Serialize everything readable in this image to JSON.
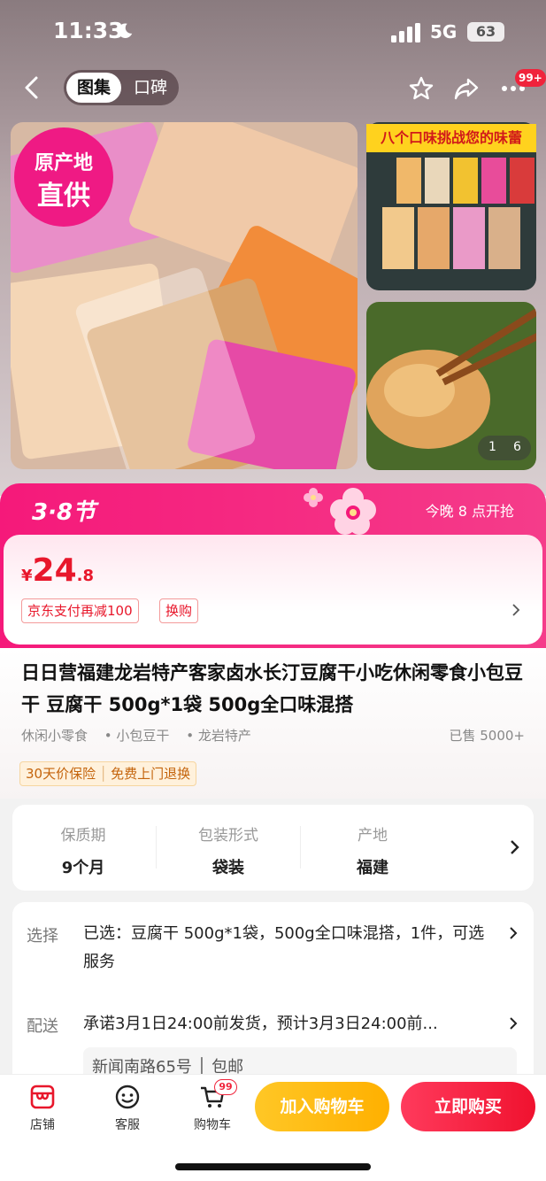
{
  "status_bar": {
    "time": "11:33",
    "network": "5G",
    "battery": "63"
  },
  "nav": {
    "tab_gallery": "图集",
    "tab_reviews": "口碑",
    "more_badge": "99+"
  },
  "gallery": {
    "origin_line1": "原产地",
    "origin_line2": "直供",
    "side_banner": "八个口味挑战您的味蕾",
    "pager_current": "1",
    "pager_total": "6"
  },
  "promo": {
    "title": "3·8节",
    "start_text": "今晚 8 点开抢",
    "currency": "¥",
    "price_int": "24",
    "price_dec": ".8",
    "tag_payment": "京东支付再减100",
    "tag_exchange": "换购"
  },
  "product": {
    "title": "日日营福建龙岩特产客家卤水长汀豆腐干小吃休闲零食小包豆干 豆腐干 500g*1袋 500g全口味混搭",
    "categories": [
      "休闲小零食",
      "• 小包豆干",
      "• 龙岩特产"
    ],
    "sold": "已售 5000+",
    "service_1": "30天价保险",
    "service_2": "免费上门退换"
  },
  "attributes": [
    {
      "key": "保质期",
      "value": "9个月"
    },
    {
      "key": "包装形式",
      "value": "袋装"
    },
    {
      "key": "产地",
      "value": "福建"
    }
  ],
  "selection": {
    "select_label": "选择",
    "select_text": "已选：豆腐干 500g*1袋，500g全口味混搭，1件，可选服务",
    "deliver_label": "配送",
    "deliver_text": "承诺3月1日24:00前发货，预计3月3日24:00前...",
    "address": "新闻南路65号 │ 包邮"
  },
  "bottom_bar": {
    "store": "店铺",
    "service": "客服",
    "cart": "购物车",
    "cart_badge": "99",
    "add_to_cart": "加入购物车",
    "buy_now": "立即购买"
  },
  "colors": {
    "accent_pink": "#f5197a",
    "price_red": "#e8172b",
    "cart_yellow": "#ffc726",
    "buy_red": "#f0122f"
  }
}
